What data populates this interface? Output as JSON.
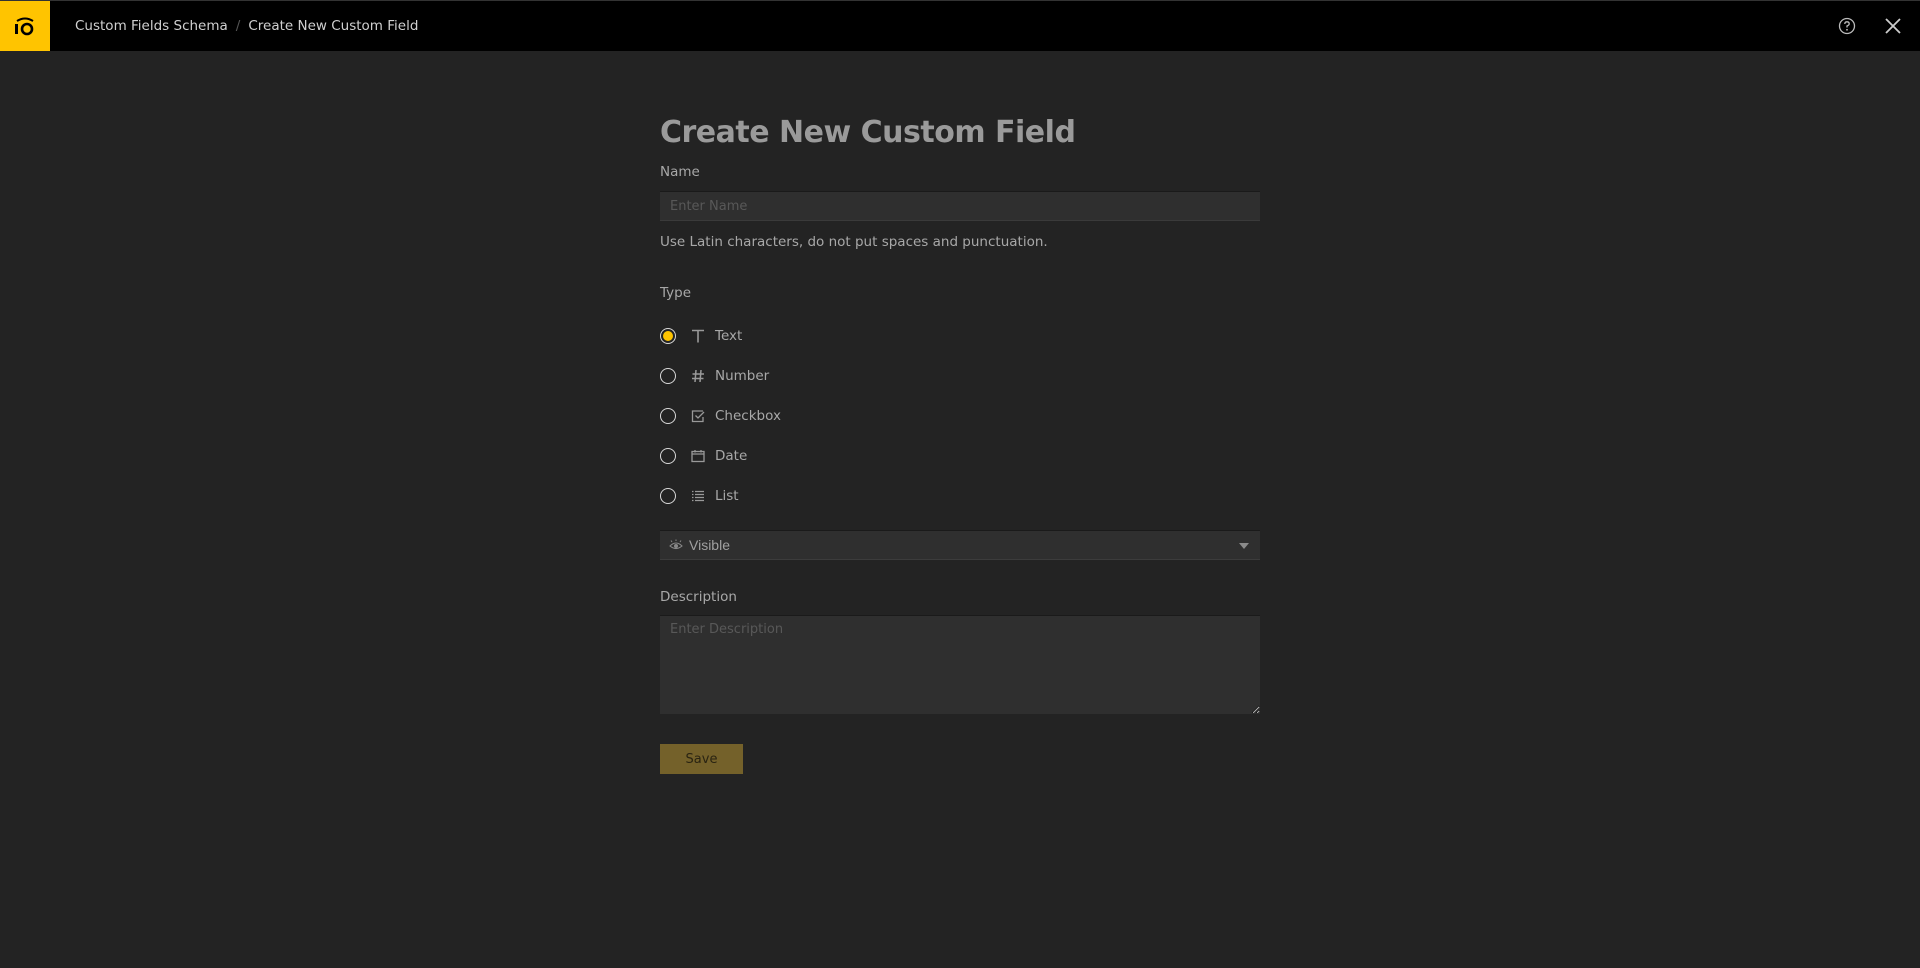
{
  "header": {
    "logo_text": "iO",
    "breadcrumb": [
      {
        "label": "Custom Fields Schema"
      },
      {
        "label": "Create New Custom Field"
      }
    ],
    "breadcrumb_separator": "/",
    "help_icon": "help-circle-icon",
    "close_icon": "close-icon"
  },
  "form": {
    "title": "Create New Custom Field",
    "name_label": "Name",
    "name_value": "",
    "name_placeholder": "Enter Name",
    "name_hint": "Use Latin characters, do not put spaces and punctuation.",
    "type_label": "Type",
    "types": [
      {
        "label": "Text",
        "icon": "text-icon",
        "checked": true
      },
      {
        "label": "Number",
        "icon": "hash-icon",
        "checked": false
      },
      {
        "label": "Checkbox",
        "icon": "checkbox-icon",
        "checked": false
      },
      {
        "label": "Date",
        "icon": "calendar-icon",
        "checked": false
      },
      {
        "label": "List",
        "icon": "list-icon",
        "checked": false
      }
    ],
    "visibility": {
      "selected": "Visible",
      "icon": "eye-icon"
    },
    "description_label": "Description",
    "description_value": "",
    "description_placeholder": "Enter Description",
    "save_label": "Save"
  },
  "colors": {
    "accent": "#ffc400",
    "background": "#232323",
    "topbar": "#000000",
    "save_button": "#74612a"
  }
}
